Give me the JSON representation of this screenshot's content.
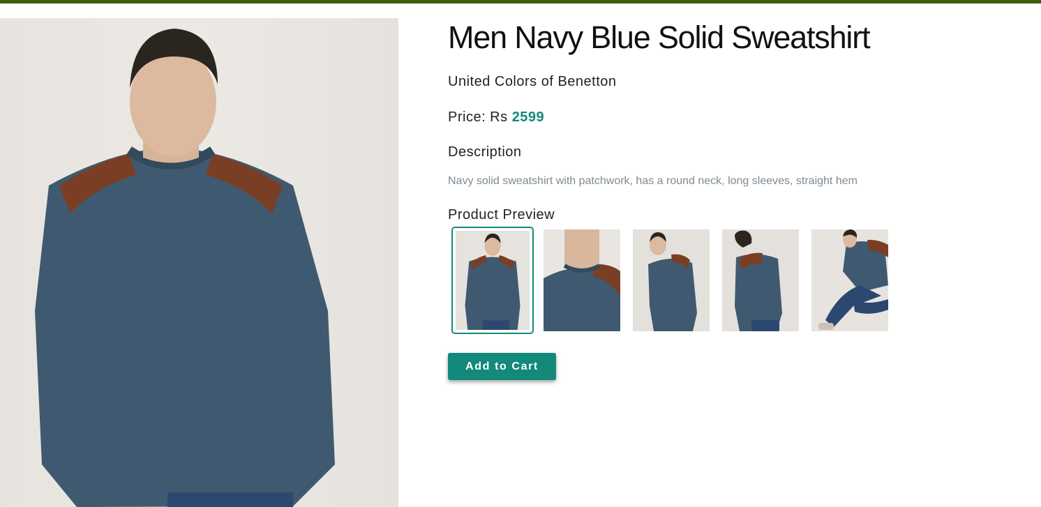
{
  "page": {
    "accent_color": "#12897a",
    "top_bar_color": "#3f5f0f"
  },
  "product": {
    "title": "Men Navy Blue Solid Sweatshirt",
    "brand": "United Colors of Benetton",
    "price_label": "Price: Rs",
    "price_value": "2599",
    "description_heading": "Description",
    "description": "Navy solid sweatshirt with patchwork, has a round neck, long sleeves, straight hem",
    "preview_heading": "Product Preview",
    "selected_preview_index": 0,
    "add_to_cart_label": "Add to Cart"
  }
}
